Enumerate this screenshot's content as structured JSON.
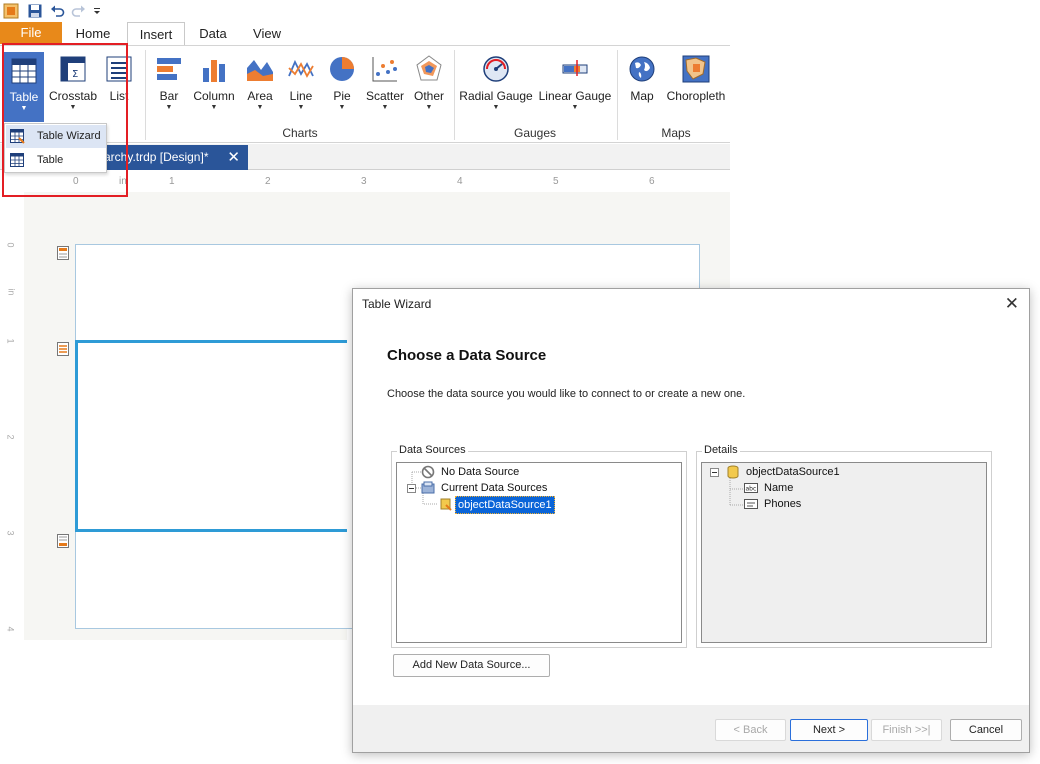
{
  "quick_access": {
    "icons": [
      "app-icon",
      "save-icon",
      "undo-icon",
      "redo-icon",
      "customize-qat-icon"
    ]
  },
  "tabs": [
    {
      "label": "File"
    },
    {
      "label": "Home"
    },
    {
      "label": "Insert"
    },
    {
      "label": "Data"
    },
    {
      "label": "View"
    }
  ],
  "ribbon": {
    "table_group": {
      "table": "Table",
      "crosstab": "Crosstab",
      "list": "List"
    },
    "charts": {
      "bar": "Bar",
      "column": "Column",
      "area": "Area",
      "line": "Line",
      "pie": "Pie",
      "scatter": "Scatter",
      "other": "Other",
      "group_label": "Charts"
    },
    "gauges": {
      "radial": "Radial Gauge",
      "linear": "Linear Gauge",
      "group_label": "Gauges"
    },
    "maps": {
      "map": "Map",
      "choropleth": "Choropleth",
      "group_label": "Maps"
    }
  },
  "dropdown": {
    "items": [
      {
        "label": "Table Wizard"
      },
      {
        "label": "Table"
      }
    ]
  },
  "doc_tab": {
    "label": "rarchy.trdp [Design]*",
    "close": "✕"
  },
  "ruler": {
    "h_ticks": [
      "0",
      "in",
      "1",
      "2",
      "3",
      "4",
      "5",
      "6"
    ],
    "v_ticks": [
      "0",
      "in",
      "1",
      "2",
      "3",
      "4"
    ]
  },
  "dialog": {
    "title": "Table Wizard",
    "close": "✕",
    "heading": "Choose a Data Source",
    "description": "Choose the data source you would like to connect to or create a new one.",
    "data_sources": {
      "label": "Data Sources",
      "nodes": [
        {
          "label": "No Data Source"
        },
        {
          "label": "Current Data Sources"
        },
        {
          "label": "objectDataSource1"
        }
      ]
    },
    "details": {
      "label": "Details",
      "nodes": [
        {
          "label": "objectDataSource1"
        },
        {
          "label": "Name"
        },
        {
          "label": "Phones"
        }
      ]
    },
    "add_button": "Add New Data Source...",
    "buttons": {
      "back": "< Back",
      "next": "Next >",
      "finish": "Finish >>|",
      "cancel": "Cancel"
    }
  },
  "colors": {
    "file_tab": "#e8891a",
    "selected_blue": "#4472c4",
    "doc_tab": "#2a5599",
    "highlight_box": "#e31e24",
    "band": "#2e9bd6"
  }
}
